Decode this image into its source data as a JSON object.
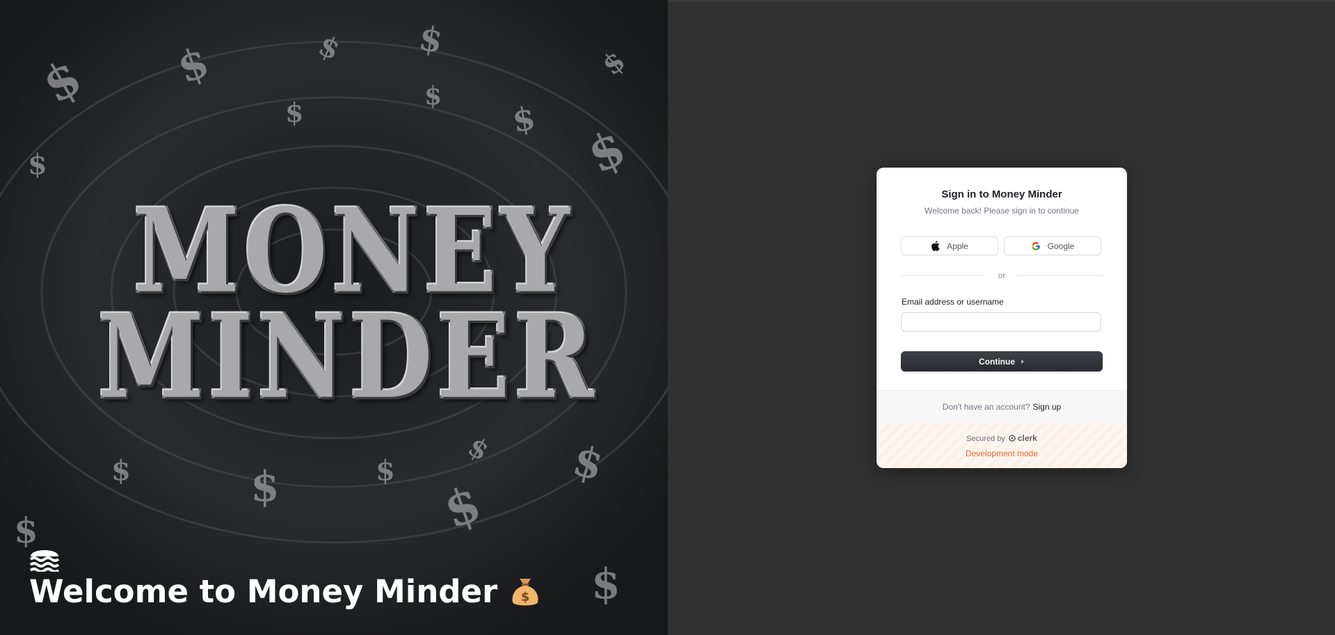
{
  "hero": {
    "title_line1": "MONEY",
    "title_line2": "MINDER",
    "welcome_text": "Welcome to Money Minder"
  },
  "icons": {
    "brand": "waves-icon",
    "money_bag": "money-bag-icon",
    "apple": "apple-icon",
    "google": "google-icon",
    "continue_arrow": "caret-right-icon"
  },
  "signin": {
    "title": "Sign in to Money Minder",
    "subtitle": "Welcome back! Please sign in to continue",
    "apple_label": "Apple",
    "google_label": "Google",
    "divider_text": "or",
    "email_label": "Email address or username",
    "email_value": "",
    "continue_label": "Continue",
    "no_account_text": "Don't have an account?",
    "signup_link": "Sign up",
    "secured_by": "Secured by",
    "clerk_brand": "clerk",
    "dev_mode": "Development mode"
  },
  "colors": {
    "page_bg": "#313131",
    "card_bg": "#ffffff",
    "primary_button": "#2f3035",
    "dev_mode_text": "#e8672a"
  }
}
